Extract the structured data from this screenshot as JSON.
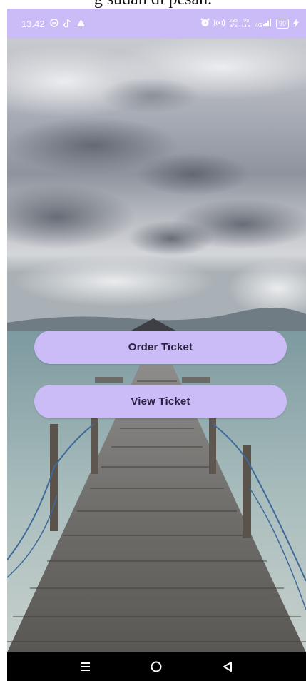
{
  "caption": {
    "text": "g sudah di pesan."
  },
  "status_bar": {
    "time": "13.42",
    "left_icons": [
      "minus-circle-icon",
      "tiktok-icon",
      "warning-icon"
    ],
    "network_speed_top": "235",
    "network_speed_bottom": "B/S",
    "volte_top": "Vo",
    "volte_bottom": "LTE",
    "network_type": "4G",
    "battery_level": "90",
    "right_icons": [
      "alarm-icon",
      "hotspot-icon",
      "signal-icon",
      "charging-icon"
    ]
  },
  "buttons": {
    "order": "Order Ticket",
    "view": "View Ticket"
  },
  "nav_bar": {
    "items": [
      "recents-icon",
      "home-icon",
      "back-icon"
    ]
  },
  "colors": {
    "accent": "#cbbcf8",
    "button_text": "#2a2040",
    "nav_bg": "#000000"
  }
}
